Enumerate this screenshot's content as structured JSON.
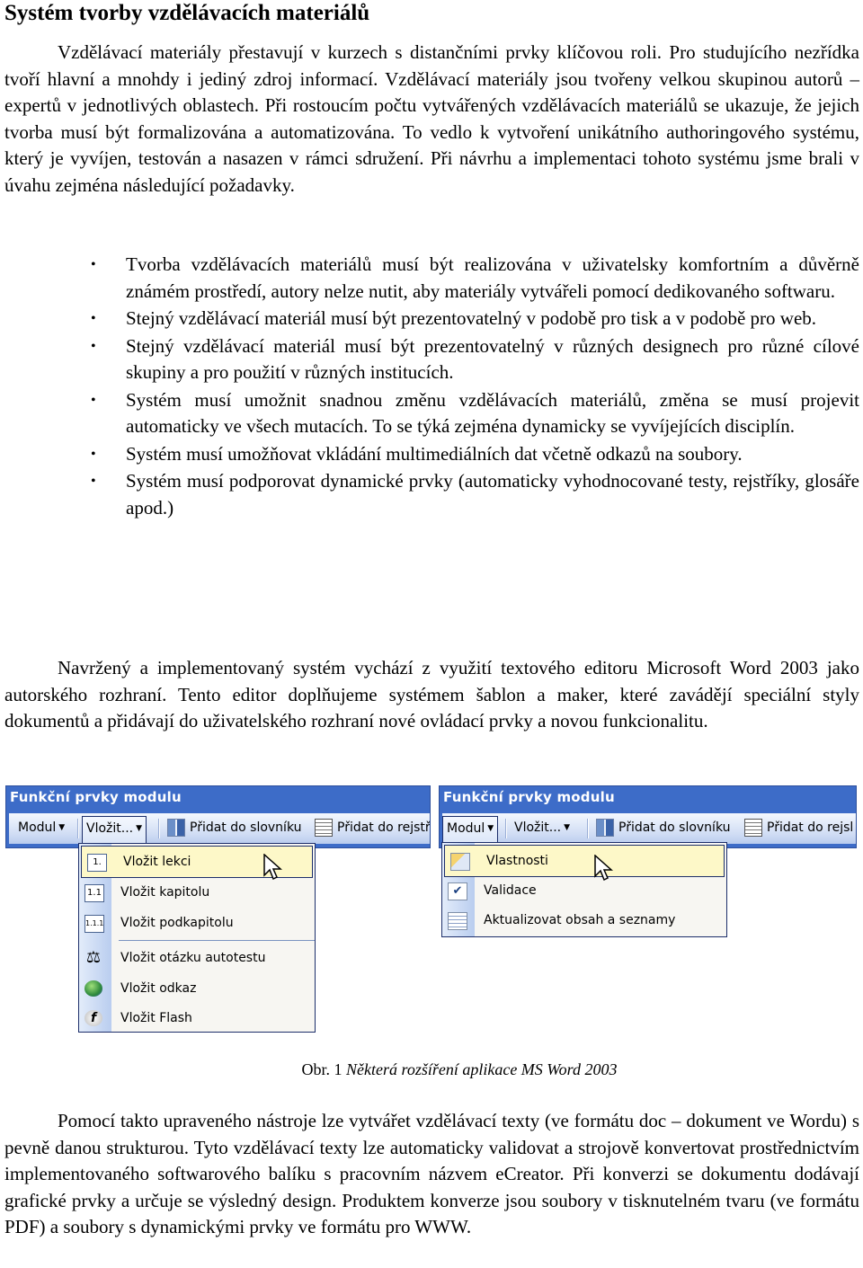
{
  "heading": "Systém tvorby vzdělávacích materiálů",
  "paragraphs": {
    "intro": "Vzdělávací materiály přestavují v kurzech s distančními prvky klíčovou roli. Pro studujícího nezřídka tvoří hlavní a mnohdy i jediný zdroj informací. Vzdělávací materiály jsou tvořeny velkou skupinou autorů – expertů v jednotlivých oblastech. Při rostoucím počtu vytvářených vzdělávacích materiálů se ukazuje, že jejich tvorba musí být formalizována a automatizována. To vedlo k vytvoření unikátního authoringového systému, který je vyvíjen, testován a nasazen v rámci sdružení. Při návrhu a implementaci tohoto systému jsme brali v úvahu zejména následující požadavky.",
    "system": "Navržený a implementovaný systém vychází z využití textového editoru Microsoft Word 2003 jako autorského rozhraní. Tento editor doplňujeme systémem šablon a maker, které zavádějí speciální styly dokumentů a přidávají do uživatelského rozhraní nové ovládací prvky a novou funkcionalitu.",
    "closing": "Pomocí takto upraveného nástroje lze vytvářet vzdělávací texty (ve formátu doc – dokument ve Wordu) s pevně danou strukturou. Tyto vzdělávací texty lze automaticky validovat a strojově konvertovat prostřednictvím implementovaného softwarového balíku s pracovním názvem eCreator. Při konverzi se dokumentu dodávají grafické prvky a určuje se výsledný design. Produktem konverze jsou soubory v tisknutelném tvaru (ve formátu PDF) a soubory s dynamickými prvky ve formátu pro WWW."
  },
  "requirements": [
    "Tvorba vzdělávacích materiálů musí být realizována v uživatelsky komfortním a důvěrně známém prostředí, autory nelze nutit, aby materiály vytvářeli pomocí dedikovaného softwaru.",
    "Stejný vzdělávací materiál musí být prezentovatelný v podobě pro tisk a v podobě pro web.",
    "Stejný vzdělávací materiál musí být prezentovatelný v různých designech pro různé cílové skupiny a pro použití v různých institucích.",
    "Systém musí umožnit snadnou změnu vzdělávacích materiálů, změna se musí projevit automaticky ve všech mutacích. To se týká zejména dynamicky se vyvíjejících disciplín.",
    "Systém musí umožňovat vkládání multimediálních dat včetně odkazů na soubory.",
    "Systém musí podporovat dynamické prvky (automaticky vyhodnocované testy, rejstříky, glosáře apod.)"
  ],
  "bullet_glyph": "•",
  "toolbar": {
    "title": "Funkční prvky modulu",
    "modul": "Modul",
    "vlozit": "Vložit...",
    "slovnik": "Přidat do slovníku",
    "rejstrik": "Přidat do rejstří",
    "rejstrik_right": "Přidat do rejsl",
    "dropdown_arrow": "▼"
  },
  "menu_vlozit": [
    {
      "icon": "1.",
      "label": "Vložit lekci",
      "highlighted": true
    },
    {
      "icon": "1.1",
      "label": "Vložit kapitolu"
    },
    {
      "icon": "1.1.1",
      "label": "Vložit podkapitolu"
    },
    {
      "icon": "⚖",
      "label": "Vložit otázku autotestu"
    },
    {
      "icon": "",
      "label": "Vložit odkaz"
    },
    {
      "icon": "f",
      "label": "Vložit Flash"
    }
  ],
  "menu_modul": [
    {
      "icon": "",
      "label": "Vlastnosti",
      "highlighted": true
    },
    {
      "icon": "✔",
      "label": "Validace"
    },
    {
      "icon": "",
      "label": "Aktualizovat obsah a seznamy"
    }
  ],
  "caption": {
    "prefix": "Obr. 1",
    "text": "Některá rozšíření aplikace MS Word 2003"
  },
  "colors": {
    "toolbar_title_bg": "#3d6cc8",
    "menu_highlight": "#fdf8c8",
    "menu_border": "#1c2e6a"
  }
}
